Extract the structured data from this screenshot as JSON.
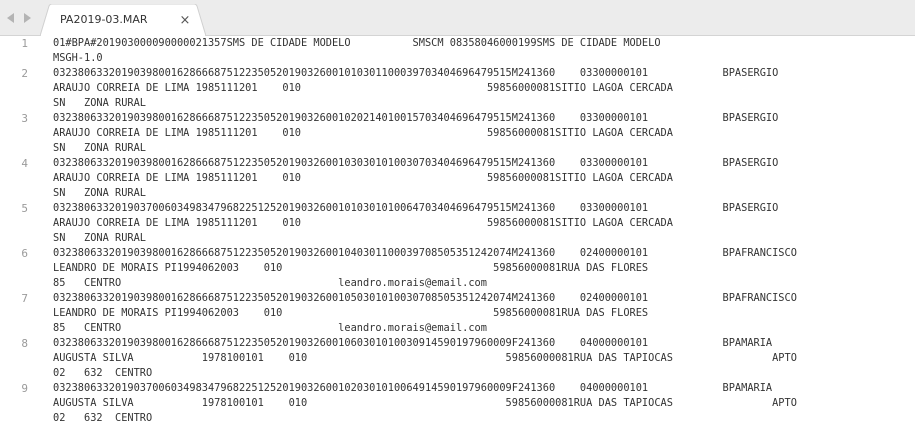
{
  "tabbar": {
    "back_arrow": "◀",
    "forward_arrow": "▶",
    "active_tab": {
      "label": "PA2019-03.MAR",
      "close_glyph": "×"
    }
  },
  "editor": {
    "lines": [
      {
        "number": "1",
        "text": "01#BPA#201903000090000021357SMS DE CIDADE MODELO          SMSCM 08358046000199SMS DE CIDADE MODELO"
      },
      {
        "number": "",
        "text": "MSGH-1.0"
      },
      {
        "number": "2",
        "text": "03238063320190398001628666875122350520190326001010301100039703404696479515M241360    03300000101            BPASERGIO"
      },
      {
        "number": "",
        "text": "ARAUJO CORREIA DE LIMA 1985111201    010                              59856000081SITIO LAGOA CERCADA"
      },
      {
        "number": "",
        "text": "SN   ZONA RURAL"
      },
      {
        "number": "3",
        "text": "03238063320190398001628666875122350520190326001020214010015703404696479515M241360    03300000101            BPASERGIO"
      },
      {
        "number": "",
        "text": "ARAUJO CORREIA DE LIMA 1985111201    010                              59856000081SITIO LAGOA CERCADA"
      },
      {
        "number": "",
        "text": "SN   ZONA RURAL"
      },
      {
        "number": "4",
        "text": "03238063320190398001628666875122350520190326001030301010030703404696479515M241360    03300000101            BPASERGIO"
      },
      {
        "number": "",
        "text": "ARAUJO CORREIA DE LIMA 1985111201    010                              59856000081SITIO LAGOA CERCADA"
      },
      {
        "number": "",
        "text": "SN   ZONA RURAL"
      },
      {
        "number": "5",
        "text": "03238063320190370060349834796822512520190326001010301010064703404696479515M241360    03300000101            BPASERGIO"
      },
      {
        "number": "",
        "text": "ARAUJO CORREIA DE LIMA 1985111201    010                              59856000081SITIO LAGOA CERCADA"
      },
      {
        "number": "",
        "text": "SN   ZONA RURAL"
      },
      {
        "number": "6",
        "text": "03238063320190398001628666875122350520190326001040301100039708505351242074M241360    02400000101            BPAFRANCISCO"
      },
      {
        "number": "",
        "text": "LEANDRO DE MORAIS PI1994062003    010                                  59856000081RUA DAS FLORES"
      },
      {
        "number": "",
        "text": "85   CENTRO                                   leandro.morais@email.com"
      },
      {
        "number": "7",
        "text": "03238063320190398001628666875122350520190326001050301010030708505351242074M241360    02400000101            BPAFRANCISCO"
      },
      {
        "number": "",
        "text": "LEANDRO DE MORAIS PI1994062003    010                                  59856000081RUA DAS FLORES"
      },
      {
        "number": "",
        "text": "85   CENTRO                                   leandro.morais@email.com"
      },
      {
        "number": "8",
        "text": "03238063320190398001628666875122350520190326001060301010030914590197960009F241360    04000000101            BPAMARIA"
      },
      {
        "number": "",
        "text": "AUGUSTA SILVA           1978100101    010                                59856000081RUA DAS TAPIOCAS                APTO"
      },
      {
        "number": "",
        "text": "02   632  CENTRO"
      },
      {
        "number": "9",
        "text": "03238063320190370060349834796822512520190326001020301010064914590197960009F241360    04000000101            BPAMARIA"
      },
      {
        "number": "",
        "text": "AUGUSTA SILVA           1978100101    010                                59856000081RUA DAS TAPIOCAS                APTO"
      },
      {
        "number": "",
        "text": "02   632  CENTRO"
      }
    ]
  }
}
